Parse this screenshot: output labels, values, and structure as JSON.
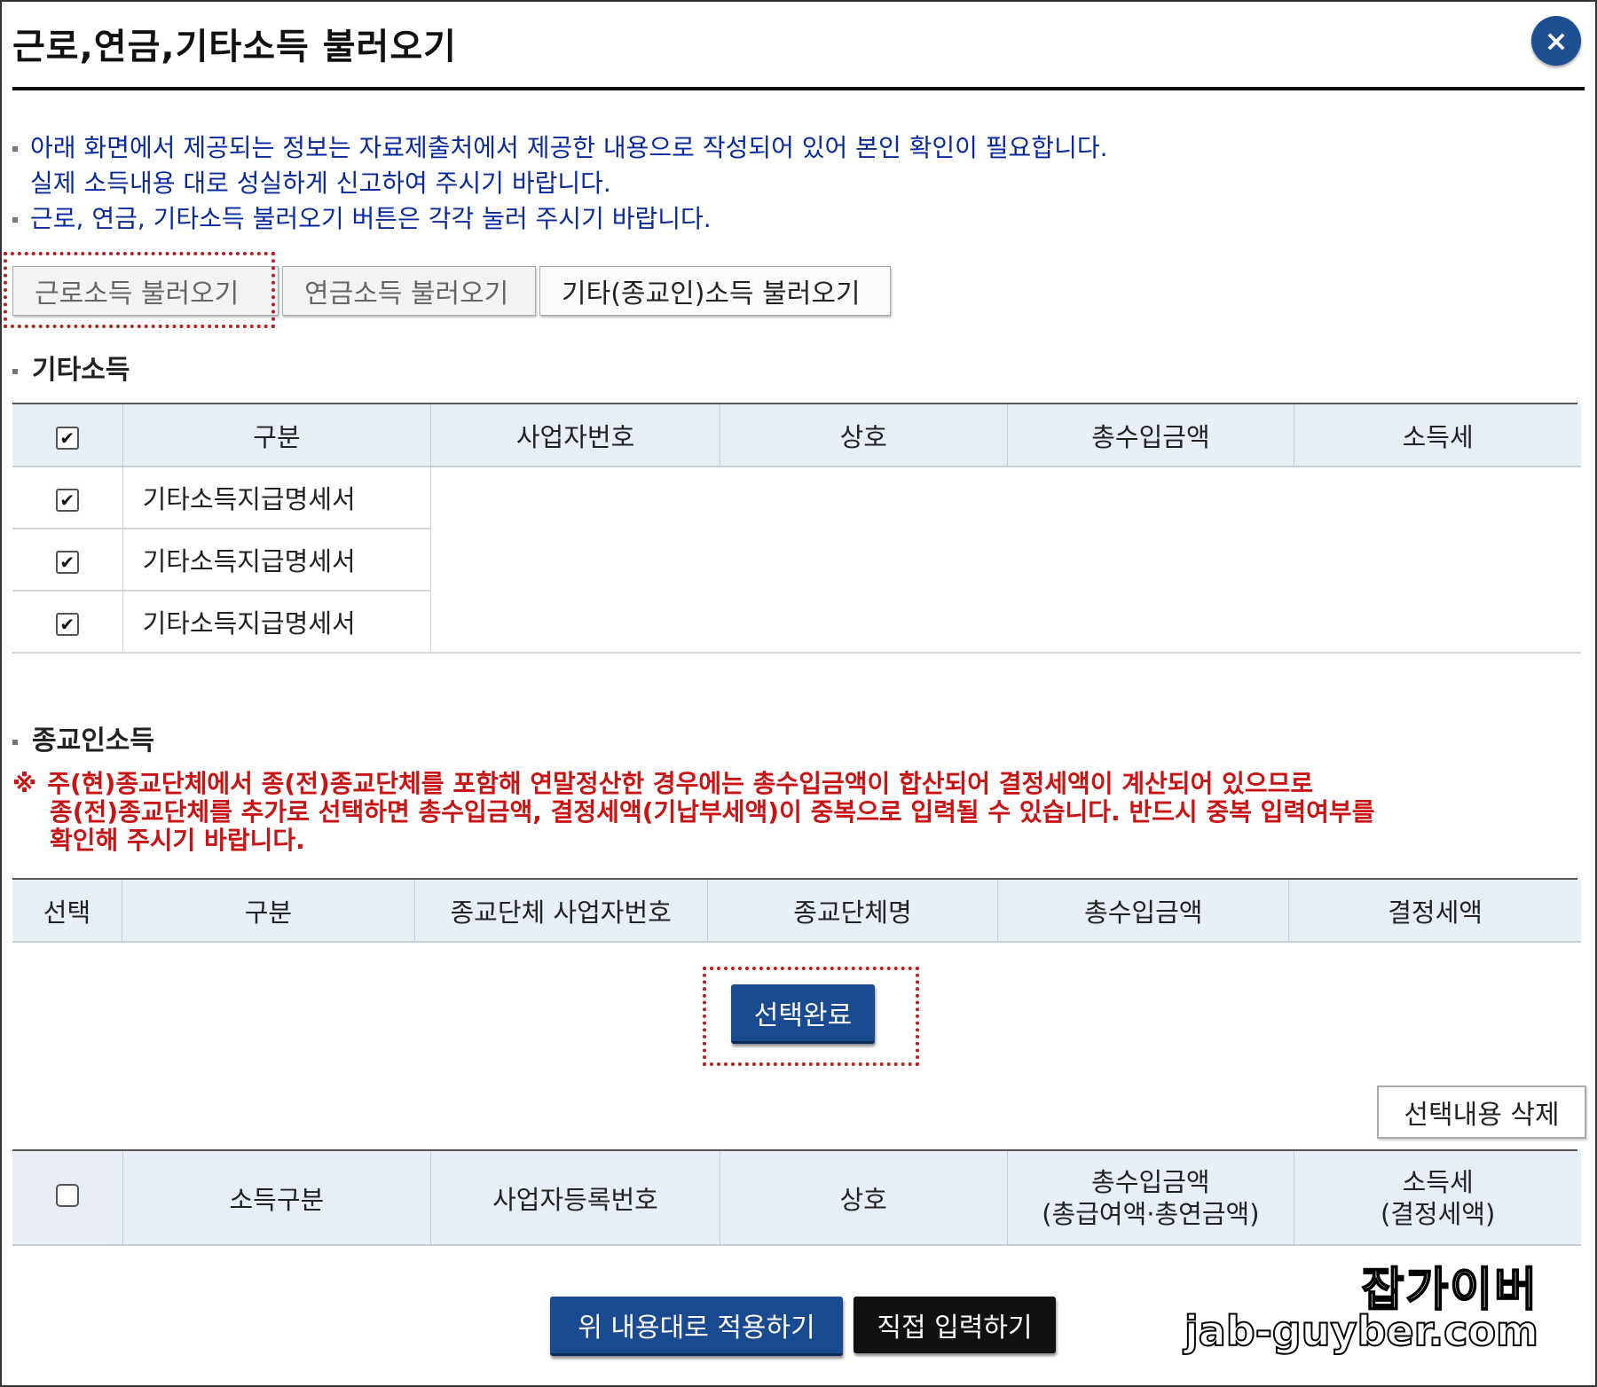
{
  "dialog": {
    "title": "근로,연금,기타소득 불러오기",
    "close_label": "×"
  },
  "notices": {
    "line1": "아래 화면에서 제공되는 정보는 자료제출처에서 제공한 내용으로 작성되어 있어 본인 확인이 필요합니다.",
    "line2": "실제 소득내용 대로 성실하게 신고하여 주시기 바랍니다.",
    "line3": "근로, 연금, 기타소득 불러오기 버튼은 각각 눌러 주시기 바랍니다."
  },
  "tabs": [
    {
      "label": "근로소득 불러오기"
    },
    {
      "label": "연금소득 불러오기"
    },
    {
      "label": "기타(종교인)소득 불러오기"
    }
  ],
  "other_income": {
    "title": "기타소득",
    "headers": [
      "구분",
      "사업자번호",
      "상호",
      "총수입금액",
      "소득세"
    ],
    "rows": [
      {
        "type": "기타소득지급명세서",
        "checked": true
      },
      {
        "type": "기타소득지급명세서",
        "checked": true
      },
      {
        "type": "기타소득지급명세서",
        "checked": true
      }
    ]
  },
  "religious_income": {
    "title": "종교인소득",
    "warning_mark": "※",
    "warning_line1": "주(현)종교단체에서 종(전)종교단체를 포함해 연말정산한 경우에는 총수입금액이 합산되어 결정세액이 계산되어 있으므로",
    "warning_line2": "종(전)종교단체를 추가로 선택하면 총수입금액, 결정세액(기납부세액)이 중복으로 입력될 수 있습니다. 반드시 중복 입력여부를",
    "warning_line3": "확인해 주시기 바랍니다.",
    "headers": [
      "선택",
      "구분",
      "종교단체 사업자번호",
      "종교단체명",
      "총수입금액",
      "결정세액"
    ],
    "select_done_label": "선택완료"
  },
  "selected": {
    "delete_label": "선택내용 삭제",
    "headers": {
      "income_type": "소득구분",
      "biz_reg_no": "사업자등록번호",
      "company": "상호",
      "total_income_1": "총수입금액",
      "total_income_2": "(총급여액·총연금액)",
      "tax_1": "소득세",
      "tax_2": "(결정세액)"
    }
  },
  "footer": {
    "apply_label": "위 내용대로 적용하기",
    "manual_label": "직접 입력하기"
  },
  "watermark": {
    "name": "잡가이버",
    "url": "jab-guyber.com"
  },
  "colors": {
    "accent_blue": "#1a4a8f",
    "notice_blue": "#0a2a9b",
    "warning_red": "#c81414",
    "header_bg": "#e8eef5",
    "highlight_red": "#b22222"
  }
}
